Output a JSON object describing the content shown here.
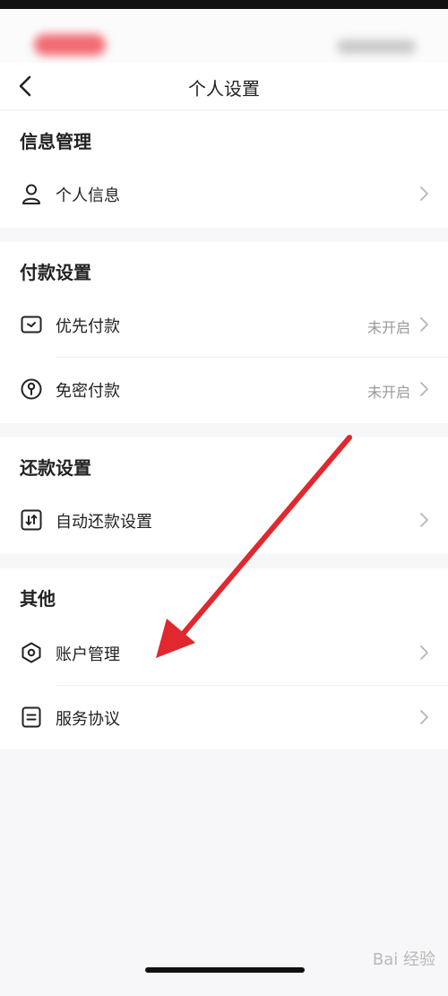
{
  "header": {
    "title": "个人设置"
  },
  "sections": [
    {
      "title": "信息管理",
      "items": [
        {
          "label": "个人信息",
          "icon": "person-icon"
        }
      ]
    },
    {
      "title": "付款设置",
      "items": [
        {
          "label": "优先付款",
          "value": "未开启",
          "icon": "card-icon"
        },
        {
          "label": "免密付款",
          "value": "未开启",
          "icon": "key-icon"
        }
      ]
    },
    {
      "title": "还款设置",
      "items": [
        {
          "label": "自动还款设置",
          "icon": "repay-icon"
        }
      ]
    },
    {
      "title": "其他",
      "items": [
        {
          "label": "账户管理",
          "icon": "hexagon-icon"
        },
        {
          "label": "服务协议",
          "icon": "document-icon"
        }
      ]
    }
  ],
  "watermark": "Bai 经验",
  "colors": {
    "annotation_arrow": "#e0282e",
    "chevron": "#b5b5b5",
    "secondary_text": "#999999"
  }
}
